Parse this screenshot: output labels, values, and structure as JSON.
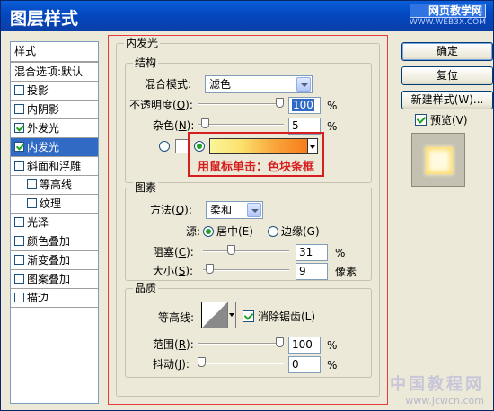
{
  "window": {
    "title": "图层样式",
    "watermark_top": "网页教学网",
    "watermark_bottom": "WWW.WEB3X.COM"
  },
  "style_list": {
    "header": "样式",
    "blend_options": "混合选项:默认",
    "items": [
      {
        "label": "投影",
        "checked": false,
        "selected": false,
        "sub": false
      },
      {
        "label": "内阴影",
        "checked": false,
        "selected": false,
        "sub": false
      },
      {
        "label": "外发光",
        "checked": true,
        "selected": false,
        "sub": false
      },
      {
        "label": "内发光",
        "checked": true,
        "selected": true,
        "sub": false
      },
      {
        "label": "斜面和浮雕",
        "checked": false,
        "selected": false,
        "sub": false
      },
      {
        "label": "等高线",
        "checked": false,
        "selected": false,
        "sub": true
      },
      {
        "label": "纹理",
        "checked": false,
        "selected": false,
        "sub": true
      },
      {
        "label": "光泽",
        "checked": false,
        "selected": false,
        "sub": false
      },
      {
        "label": "颜色叠加",
        "checked": false,
        "selected": false,
        "sub": false
      },
      {
        "label": "渐变叠加",
        "checked": false,
        "selected": false,
        "sub": false
      },
      {
        "label": "图案叠加",
        "checked": false,
        "selected": false,
        "sub": false
      },
      {
        "label": "描边",
        "checked": false,
        "selected": false,
        "sub": false
      }
    ]
  },
  "inner_glow": {
    "title": "内发光",
    "structure": {
      "title": "结构",
      "blend_mode_label": "混合模式:",
      "blend_mode_value": "滤色",
      "opacity_label_pre": "不透明度(",
      "opacity_key": "O",
      "opacity_label_post": "):",
      "opacity_value": "100",
      "opacity_fraction": 1.0,
      "noise_label_pre": "杂色(",
      "noise_key": "N",
      "noise_label_post": "):",
      "noise_value": "5",
      "noise_fraction": 0.05,
      "percent": "%"
    },
    "gradient_colors": [
      "#fbf59a",
      "#fbe06b",
      "#f9a43a",
      "#f67d1b"
    ],
    "annotation": "用鼠标单击：色块条框",
    "elements": {
      "title": "图素",
      "method_label_pre": "方法(",
      "method_key": "Q",
      "method_label_post": "):",
      "method_value": "柔和",
      "source_label": "源:",
      "source_center": "居中(E)",
      "source_edge": "边缘(G)",
      "choke_label_pre": "阻塞(",
      "choke_key": "C",
      "choke_label_post": "):",
      "choke_value": "31",
      "choke_fraction": 0.31,
      "size_label_pre": "大小(",
      "size_key": "S",
      "size_label_post": "):",
      "size_value": "9",
      "size_fraction": 0.036,
      "percent": "%",
      "pixels": "像素"
    },
    "quality": {
      "title": "品质",
      "contour_label": "等高线:",
      "anti_alias_label": "消除锯齿(L)",
      "anti_alias_checked": true,
      "range_label_pre": "范围(",
      "range_key": "R",
      "range_label_post": "):",
      "range_value": "100",
      "range_fraction": 1.0,
      "jitter_label_pre": "抖动(",
      "jitter_key": "J",
      "jitter_label_post": "):",
      "jitter_value": "0",
      "jitter_fraction": 0.0,
      "percent": "%"
    }
  },
  "buttons": {
    "ok": "确定",
    "reset": "复位",
    "new_style": "新建样式(W)...",
    "preview_label": "预览(V)",
    "preview_checked": true
  },
  "footer_watermark": {
    "big": "中国教程网",
    "small": "www.jcwcn.com"
  }
}
